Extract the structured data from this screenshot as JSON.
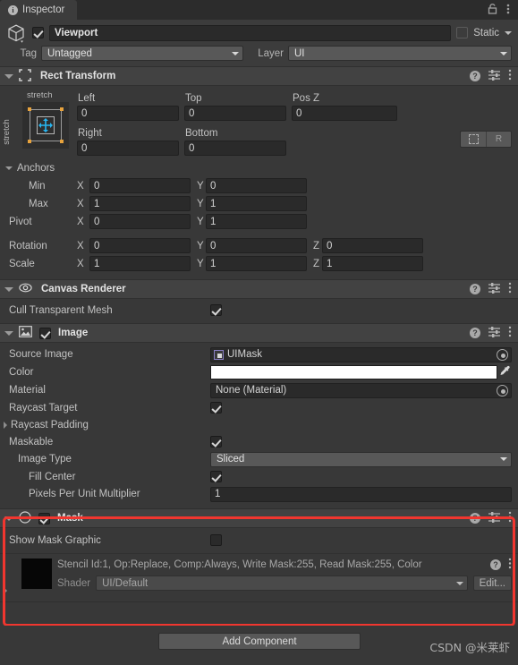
{
  "window": {
    "tab_label": "Inspector",
    "tab_icon": "info-icon",
    "lock_icon": "lock-icon",
    "menu_icon": "kebab-menu-icon"
  },
  "gameobject": {
    "enabled": true,
    "name": "Viewport",
    "static_label": "Static",
    "static_checked": false,
    "tag_label": "Tag",
    "tag_value": "Untagged",
    "layer_label": "Layer",
    "layer_value": "UI"
  },
  "rect_transform": {
    "title": "Rect Transform",
    "anchor_preset": {
      "horizontal": "stretch",
      "vertical": "stretch"
    },
    "headers": {
      "left": "Left",
      "top": "Top",
      "posz": "Pos Z",
      "right": "Right",
      "bottom": "Bottom"
    },
    "values": {
      "left": "0",
      "top": "0",
      "posz": "0",
      "right": "0",
      "bottom": "0"
    },
    "blueprint_button": "blueprint-mode-icon",
    "raw_button": "R",
    "anchors_label": "Anchors",
    "min_label": "Min",
    "min_x": "0",
    "min_y": "0",
    "max_label": "Max",
    "max_x": "1",
    "max_y": "1",
    "pivot_label": "Pivot",
    "pivot_x": "0",
    "pivot_y": "1",
    "rotation_label": "Rotation",
    "rot_x": "0",
    "rot_y": "0",
    "rot_z": "0",
    "scale_label": "Scale",
    "scale_x": "1",
    "scale_y": "1",
    "scale_z": "1",
    "axis_x": "X",
    "axis_y": "Y",
    "axis_z": "Z"
  },
  "canvas_renderer": {
    "title": "Canvas Renderer",
    "cull_label": "Cull Transparent Mesh",
    "cull_checked": true
  },
  "image": {
    "title": "Image",
    "enabled": true,
    "source_image_label": "Source Image",
    "source_image_value": "UIMask",
    "color_label": "Color",
    "color_value": "#FFFFFF",
    "material_label": "Material",
    "material_value": "None (Material)",
    "raycast_target_label": "Raycast Target",
    "raycast_target_checked": true,
    "raycast_padding_label": "Raycast Padding",
    "maskable_label": "Maskable",
    "maskable_checked": true,
    "image_type_label": "Image Type",
    "image_type_value": "Sliced",
    "fill_center_label": "Fill Center",
    "fill_center_checked": true,
    "ppu_label": "Pixels Per Unit Multiplier",
    "ppu_value": "1"
  },
  "mask": {
    "title": "Mask",
    "enabled": true,
    "show_mask_graphic_label": "Show Mask Graphic",
    "show_mask_graphic_checked": false,
    "highlight_color": "#F1362F"
  },
  "material_preview": {
    "description": "Stencil Id:1, Op:Replace, Comp:Always, Write Mask:255, Read Mask:255, Color",
    "shader_label": "Shader",
    "shader_value": "UI/Default",
    "edit_label": "Edit..."
  },
  "footer": {
    "add_component_label": "Add Component",
    "watermark": "CSDN @米莱虾"
  }
}
